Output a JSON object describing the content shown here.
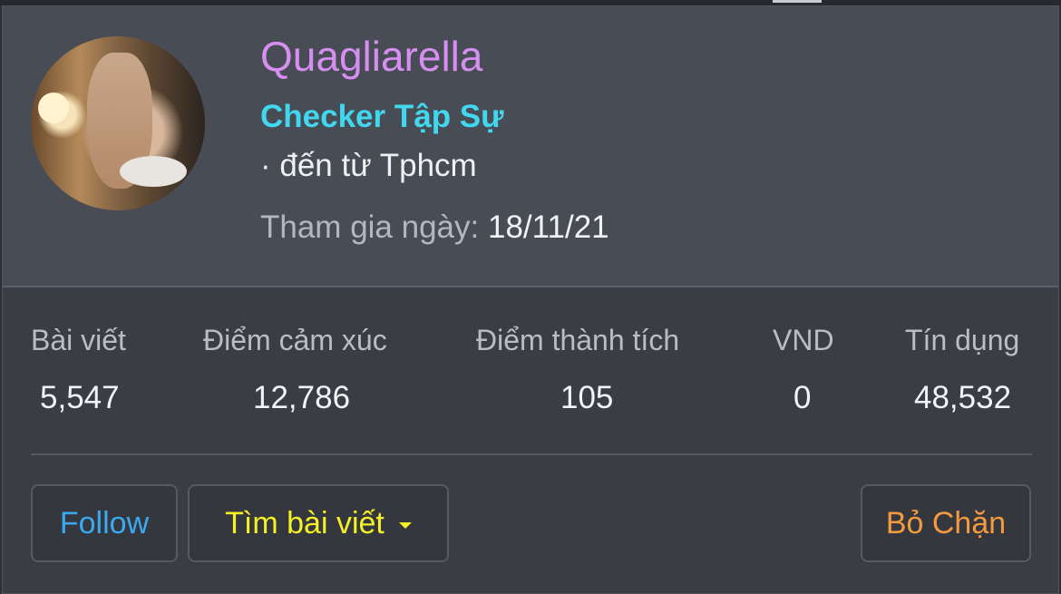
{
  "profile": {
    "username": "Quagliarella",
    "title": "Checker Tập Sự",
    "location": "· đến từ Tphcm",
    "joined_label": "Tham gia ngày:",
    "joined_date": "18/11/21"
  },
  "stats": [
    {
      "label": "Bài viết",
      "value": "5,547"
    },
    {
      "label": "Điểm cảm xúc",
      "value": "12,786"
    },
    {
      "label": "Điểm thành tích",
      "value": "105"
    },
    {
      "label": "VND",
      "value": "0"
    },
    {
      "label": "Tín dụng",
      "value": "48,532"
    }
  ],
  "actions": {
    "follow": "Follow",
    "find_posts": "Tìm bài viết",
    "unblock": "Bỏ Chặn"
  },
  "colors": {
    "username": "#d68ef0",
    "title": "#40d7ef",
    "follow": "#3aa9ef",
    "find_posts": "#f5f126",
    "unblock": "#f39a3f"
  },
  "icons": {
    "dropdown": "caret-down-icon"
  }
}
